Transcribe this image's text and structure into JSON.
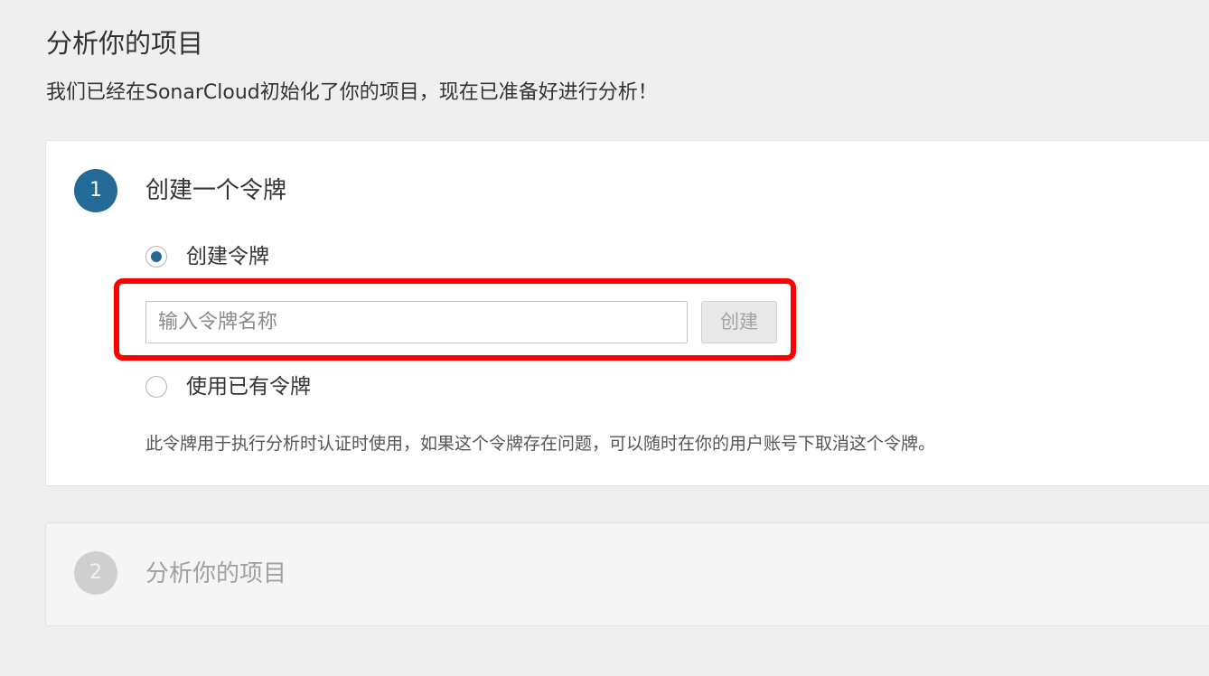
{
  "page": {
    "title": "分析你的项目",
    "subtitle": "我们已经在SonarCloud初始化了你的项目，现在已准备好进行分析！"
  },
  "step1": {
    "number": "1",
    "title": "创建一个令牌",
    "option_create_label": "创建令牌",
    "option_create_selected": true,
    "token_input": {
      "value": "",
      "placeholder": "输入令牌名称"
    },
    "create_button_label": "创建",
    "create_button_disabled": true,
    "option_existing_label": "使用已有令牌",
    "option_existing_selected": false,
    "help_text": "此令牌用于执行分析时认证时使用，如果这个令牌存在问题，可以随时在你的用户账号下取消这个令牌。"
  },
  "step2": {
    "number": "2",
    "title": "分析你的项目"
  },
  "colors": {
    "accent": "#236a97",
    "highlight": "#ff0000",
    "inactive_step": "#cfcfcf",
    "background": "#efefef"
  }
}
